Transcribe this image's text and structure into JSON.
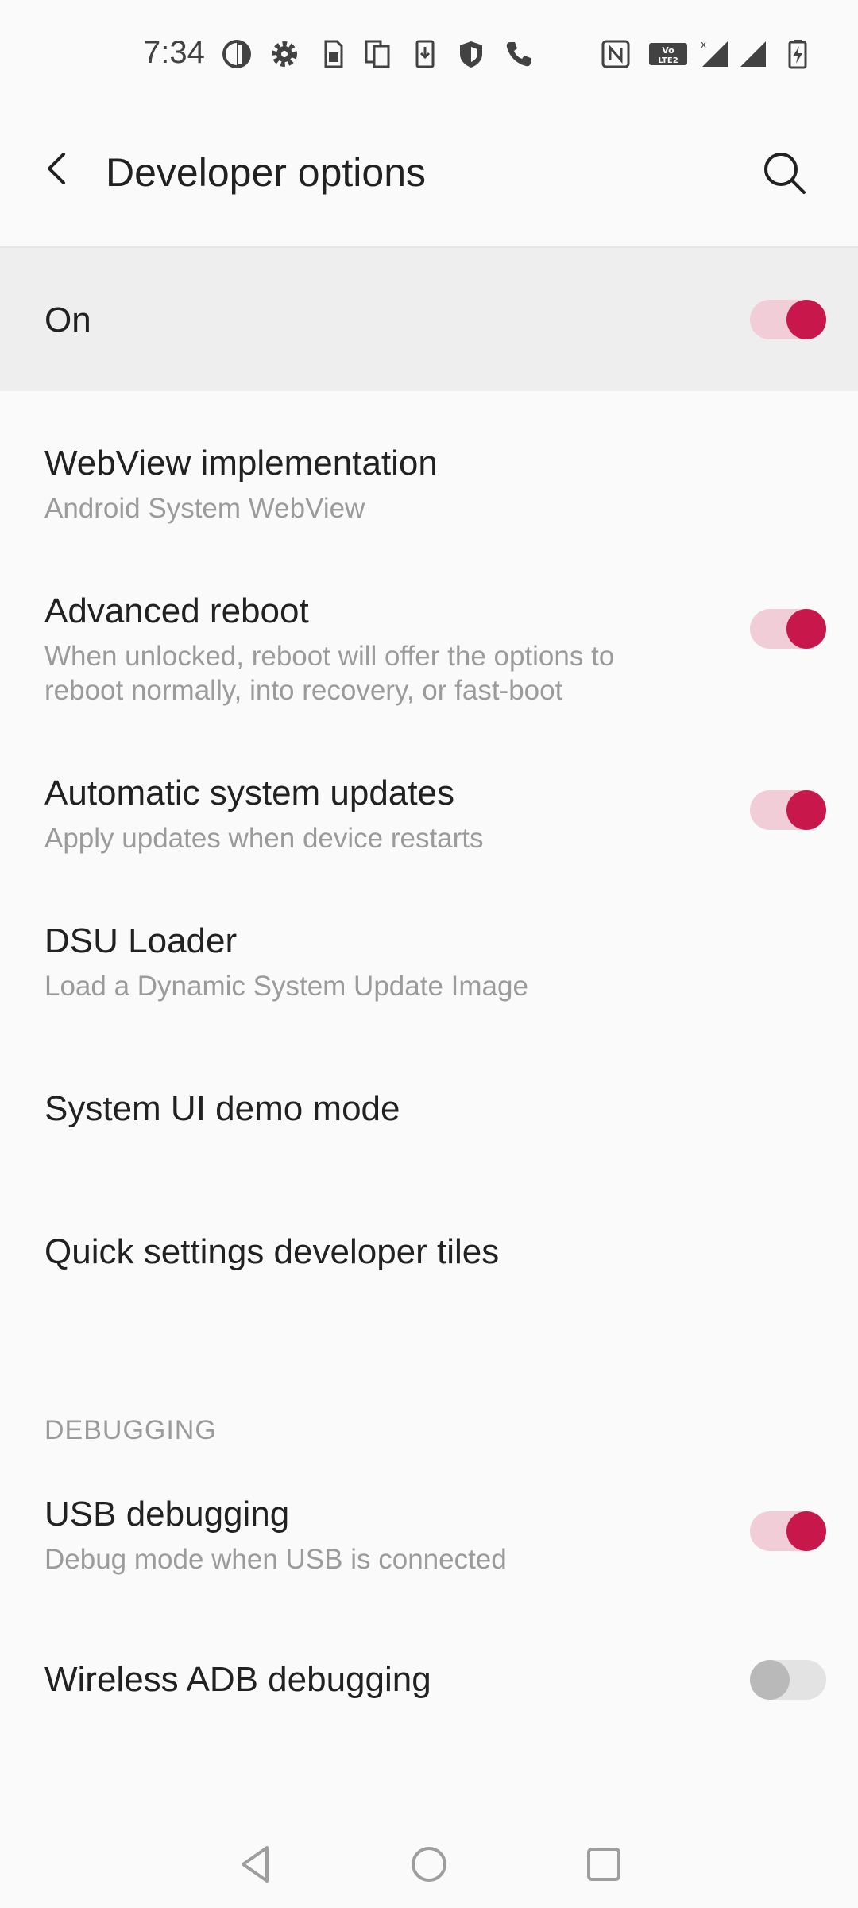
{
  "status_bar": {
    "time": "7:34",
    "icons": [
      "pie-icon",
      "gear-icon",
      "sim-card-icon",
      "copy-icon",
      "download-icon",
      "shield-icon",
      "phone-icon",
      "nfc-icon",
      "volte-icon",
      "signal-icon",
      "signal-icon",
      "battery-charging-icon"
    ]
  },
  "app_bar": {
    "title": "Developer options",
    "back_icon": "back-arrow-icon",
    "search_icon": "search-icon"
  },
  "master_switch": {
    "label": "On",
    "checked": true
  },
  "colors": {
    "accent": "#c8174b",
    "track_on": "#f1cdd7",
    "summary_text": "#9b9b9b"
  },
  "items": [
    {
      "title": "WebView implementation",
      "summary": "Android System WebView"
    },
    {
      "title": "Advanced reboot",
      "summary": "When unlocked, reboot will offer the options to reboot normally, into recovery, or fast-boot",
      "toggle": true
    },
    {
      "title": "Automatic system updates",
      "summary": "Apply updates when device restarts",
      "toggle": true
    },
    {
      "title": "DSU Loader",
      "summary": "Load a Dynamic System Update Image"
    },
    {
      "title": "System UI demo mode"
    },
    {
      "title": "Quick settings developer tiles"
    }
  ],
  "debugging": {
    "header": "DEBUGGING",
    "items": [
      {
        "title": "USB debugging",
        "summary": "Debug mode when USB is connected",
        "toggle": true
      },
      {
        "title": "Wireless ADB debugging",
        "toggle": false
      }
    ]
  },
  "nav_bar": {
    "back": "nav-back-icon",
    "home": "nav-home-icon",
    "recents": "nav-recents-icon"
  }
}
